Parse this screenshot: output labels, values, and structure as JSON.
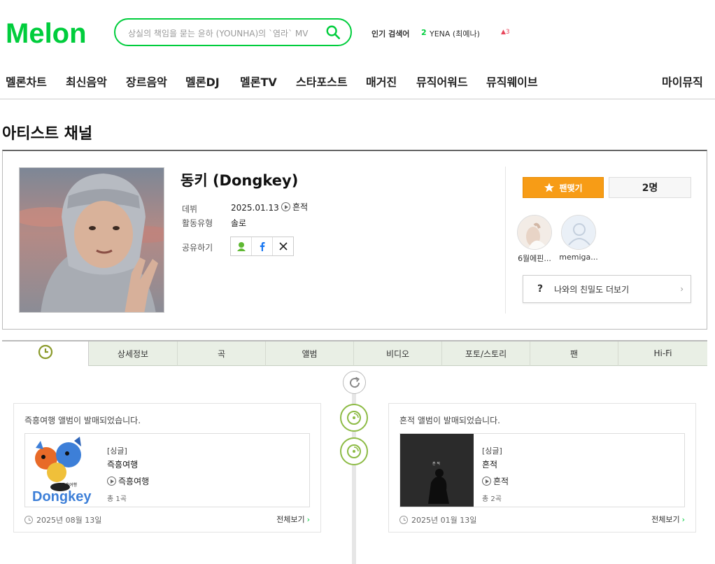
{
  "header": {
    "logo": "Melon",
    "search_placeholder": "상실의 책임을 묻는 윤하 (YOUNHA)의 `염라` MV",
    "popular_label": "인기 검색어",
    "popular_rank": "2",
    "popular_word": "YENA (최예나)",
    "popular_change": "▲3"
  },
  "nav": {
    "items": [
      "멜론차트",
      "최신음악",
      "장르음악",
      "멜론DJ",
      "멜론TV",
      "스타포스트",
      "매거진",
      "뮤직어워드",
      "뮤직웨이브"
    ],
    "my_music": "마이뮤직"
  },
  "page_title": "아티스트 채널",
  "artist": {
    "name": "동키 (Dongkey)",
    "debut_label": "데뷔",
    "debut_date": "2025.01.13",
    "debut_song": "흔적",
    "type_label": "활동유형",
    "type_value": "솔로",
    "share_label": "공유하기",
    "fan_button": "팬맺기",
    "fan_count": "2명",
    "fans": [
      {
        "name": "6월에핀..."
      },
      {
        "name": "memiga..."
      }
    ],
    "intimacy_icon": "?",
    "intimacy_label": "나와의 친밀도 더보기",
    "intimacy_chevron": "›"
  },
  "tabs": [
    "상세정보",
    "곡",
    "앨범",
    "비디오",
    "포토/스토리",
    "팬",
    "Hi-Fi"
  ],
  "timeline": [
    {
      "message": "즉흥여행 앨범이 발매되었습니다.",
      "album_type": "[싱글]",
      "album_title": "즉흥여행",
      "track": "즉흥여행",
      "track_count": "총 1곡",
      "date": "2025년 08월 13일",
      "more": "전체보기",
      "more_arrow": "›"
    },
    {
      "message": "흔적 앨범이 발매되었습니다.",
      "album_type": "[싱글]",
      "album_title": "흔적",
      "track": "흔적",
      "track_count": "총 2곡",
      "date": "2025년 01월 13일",
      "more": "전체보기",
      "more_arrow": "›"
    }
  ],
  "colors": {
    "brand": "#00cd3c",
    "fan_button": "#f79c16",
    "timeline_node": "#8dbb45",
    "tab_bg": "#e9efe5"
  }
}
